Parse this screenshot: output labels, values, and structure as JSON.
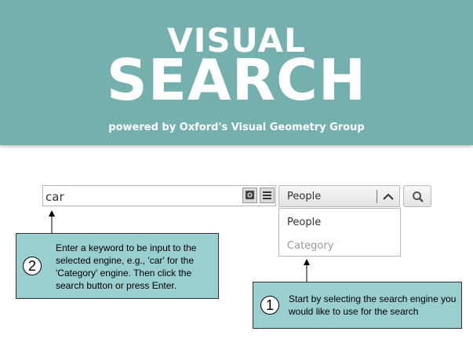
{
  "header": {
    "title_line1": "VISUAL",
    "title_line2": "SEARCH",
    "powered_by": "powered by Oxford's Visual Geometry Group",
    "background_color": "#74b0ad"
  },
  "search": {
    "query_value": "car",
    "image_button_icon": "image-icon",
    "list_button_icon": "list-icon",
    "search_button_icon": "magnifier-icon"
  },
  "engine_select": {
    "selected": "People",
    "options": [
      "People",
      "Category"
    ]
  },
  "callouts": {
    "step2": {
      "number": "2",
      "text": "Enter a keyword to be input to the selected engine, e.g., 'car' for the 'Category' engine. Then click the search button or press Enter."
    },
    "step1": {
      "number": "1",
      "text": "Start by selecting the search engine you would like to use for the search"
    }
  }
}
